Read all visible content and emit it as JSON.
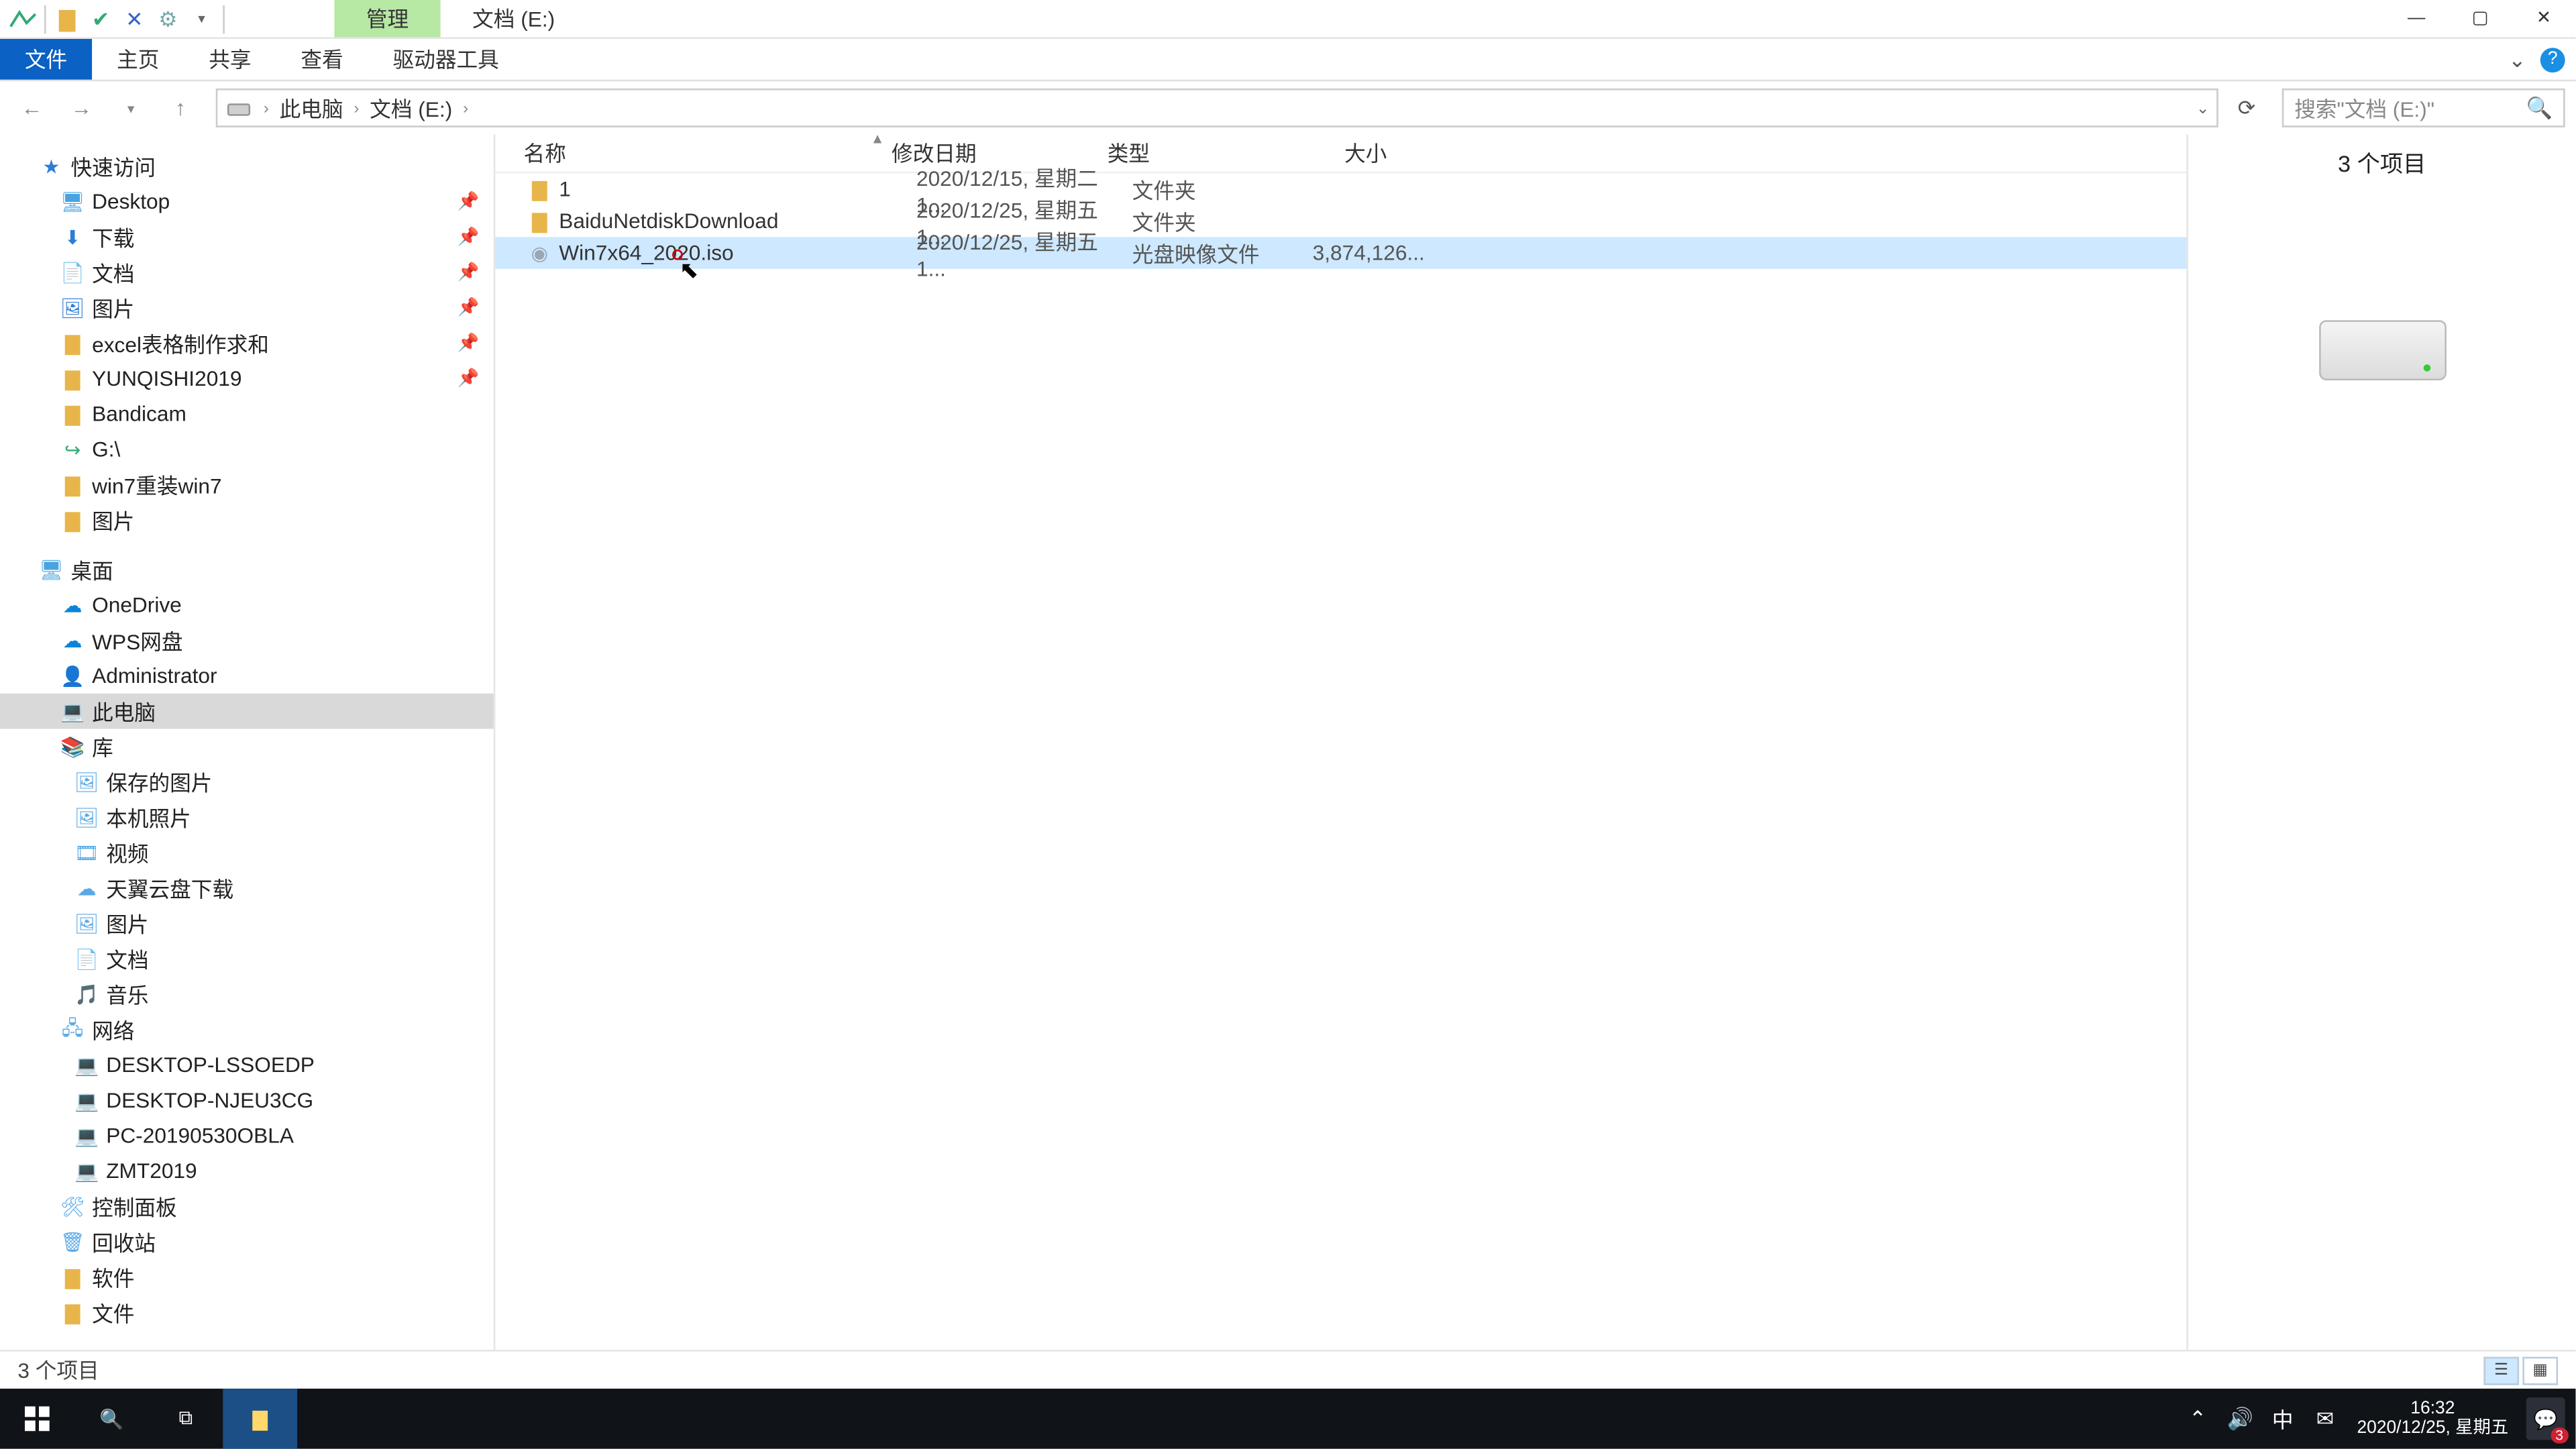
{
  "titlebar": {
    "manage_tab": "管理",
    "path_tab": "文档 (E:)"
  },
  "ribbon": {
    "file": "文件",
    "home": "主页",
    "share": "共享",
    "view": "查看",
    "drive_tools": "驱动器工具",
    "collapse_chevron": "⌄",
    "help": "?"
  },
  "address": {
    "back": "←",
    "forward": "→",
    "up": "↑",
    "crumb1": "此电脑",
    "crumb2": "文档 (E:)",
    "refresh": "⟳",
    "dropdown": "⌄"
  },
  "search": {
    "placeholder": "搜索\"文档 (E:)\""
  },
  "nav": {
    "quick_access": "快速访问",
    "desktop": "Desktop",
    "downloads": "下载",
    "documents": "文档",
    "pictures": "图片",
    "excel": "excel表格制作求和",
    "yunqishi": "YUNQISHI2019",
    "bandicam": "Bandicam",
    "g_drive": "G:\\",
    "win7reinstall": "win7重装win7",
    "pictures2": "图片",
    "desktop_cn": "桌面",
    "onedrive": "OneDrive",
    "wps": "WPS网盘",
    "admin": "Administrator",
    "this_pc": "此电脑",
    "libraries": "库",
    "saved_pics": "保存的图片",
    "camera_roll": "本机照片",
    "videos": "视频",
    "tianyi": "天翼云盘下载",
    "pictures3": "图片",
    "documents2": "文档",
    "music": "音乐",
    "network": "网络",
    "pc_lssoedp": "DESKTOP-LSSOEDP",
    "pc_njeu3cg": "DESKTOP-NJEU3CG",
    "pc_2019": "PC-20190530OBLA",
    "zmt": "ZMT2019",
    "control_panel": "控制面板",
    "recycle": "回收站",
    "software": "软件",
    "documents3": "文件"
  },
  "columns": {
    "name": "名称",
    "date": "修改日期",
    "type": "类型",
    "size": "大小"
  },
  "files": [
    {
      "name": "1",
      "date": "2020/12/15, 星期二 1...",
      "type": "文件夹",
      "size": "",
      "icon": "folder"
    },
    {
      "name": "BaiduNetdiskDownload",
      "date": "2020/12/25, 星期五 1...",
      "type": "文件夹",
      "size": "",
      "icon": "folder"
    },
    {
      "name": "Win7x64_2020.iso",
      "date": "2020/12/25, 星期五 1...",
      "type": "光盘映像文件",
      "size": "3,874,126...",
      "icon": "file",
      "selected": true
    }
  ],
  "preview": {
    "count_label": "3 个项目"
  },
  "status": {
    "text": "3 个项目"
  },
  "taskbar": {
    "time": "16:32",
    "date": "2020/12/25, 星期五",
    "ime": "中",
    "badge": "3"
  }
}
